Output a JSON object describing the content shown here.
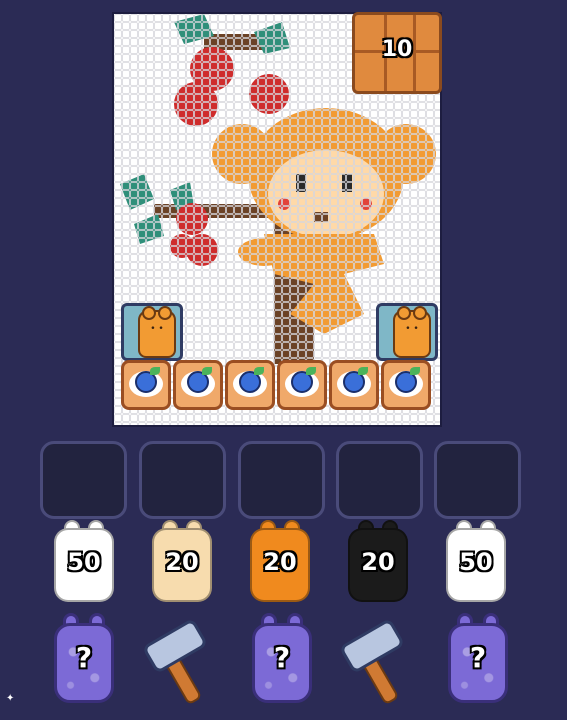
{
  "game": {
    "crate": {
      "count": "10",
      "icon": "crate-icon",
      "color": "#e08a3e"
    },
    "board": {
      "picture": "pixel-art-bear-with-cherries",
      "colors": {
        "bear": "#f29b33",
        "cherry": "#cf2c2c",
        "leaf": "#2f8f7a",
        "trunk": "#6b4226",
        "background": "#ffffff"
      }
    },
    "pens": [
      {
        "icon": "bear-creature-icon",
        "color": "#f29b33"
      },
      {
        "icon": "bear-creature-icon",
        "color": "#f29b33"
      }
    ],
    "trays": [
      {
        "icon": "blueberry-icon"
      },
      {
        "icon": "blueberry-icon"
      },
      {
        "icon": "blueberry-icon"
      },
      {
        "icon": "blueberry-icon"
      },
      {
        "icon": "blueberry-icon"
      },
      {
        "icon": "blueberry-icon"
      }
    ],
    "slots_empty": 5,
    "bags": [
      {
        "count": "50",
        "color": "#ffffff"
      },
      {
        "count": "20",
        "color": "#f7dcae"
      },
      {
        "count": "20",
        "color": "#f08a1e"
      },
      {
        "count": "20",
        "color": "#1b1b1b"
      },
      {
        "count": "50",
        "color": "#ffffff"
      }
    ],
    "bottom_row": [
      {
        "type": "mystery",
        "label": "?"
      },
      {
        "type": "hammer",
        "icon": "hammer-icon"
      },
      {
        "type": "mystery",
        "label": "?"
      },
      {
        "type": "hammer",
        "icon": "hammer-icon"
      },
      {
        "type": "mystery",
        "label": "?"
      }
    ]
  }
}
